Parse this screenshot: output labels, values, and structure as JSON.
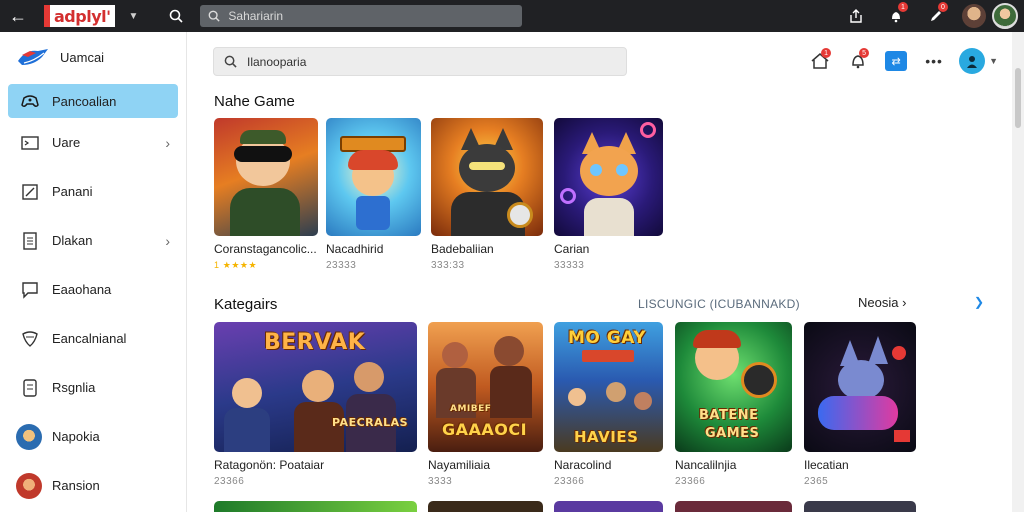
{
  "topbar": {
    "brand": "adplyl'",
    "search_placeholder": "Sahariarin",
    "badges": [
      "1",
      "1",
      "0"
    ]
  },
  "sidebar": {
    "brand_label": "Uamcai",
    "items": [
      {
        "label": "Pancoalian",
        "icon": "gamepad-icon",
        "active": true
      },
      {
        "label": "Uare",
        "icon": "screen-icon",
        "chevron": true
      },
      {
        "label": "Panani",
        "icon": "edit-icon"
      },
      {
        "label": "Dlakan",
        "icon": "document-icon",
        "chevron": true
      },
      {
        "label": "Eaaohana",
        "icon": "chat-icon"
      },
      {
        "label": "Eancalnianal",
        "icon": "shield-icon"
      },
      {
        "label": "Rsgnlia",
        "icon": "tablet-icon"
      },
      {
        "label": "Napokia",
        "icon": "avatar"
      },
      {
        "label": "Ransion",
        "icon": "avatar"
      }
    ]
  },
  "main": {
    "search_placeholder": "Ilanooparia",
    "action_badges": [
      "1",
      "5"
    ],
    "section1_title": "Nahe Game",
    "games": [
      {
        "title": "Coranstagancolic...",
        "sub": "",
        "stars": "★★★★",
        "rating": "1"
      },
      {
        "title": "Nacadhirid",
        "sub": "23333"
      },
      {
        "title": "Badebaliian",
        "sub": "333:33"
      },
      {
        "title": "Carian",
        "sub": "33333"
      }
    ],
    "section2_title": "Kategairs",
    "filter_text": "LISCUNGIC (ICUBANNAKD)",
    "see_more": "Neosia",
    "categories": [
      {
        "title": "Ratagonön:",
        "title2": "Poataiar",
        "sub": "23366",
        "art_text": "BERVAK",
        "art_sub": "PAECRALAS"
      },
      {
        "title": "Nayamiliaia",
        "sub": "3333",
        "art_text": "GAAAOCI",
        "art_sub": "AMIBEF"
      },
      {
        "title": "Naracolind",
        "sub": "23366",
        "art_text": "MO GAY",
        "art_sub": "HAVIES"
      },
      {
        "title": "Nancalilnjia",
        "sub": "23366",
        "art_text": "BATENE",
        "art_sub": "GAMES"
      },
      {
        "title": "Ilecatian",
        "sub": "2365"
      }
    ]
  },
  "colors": {
    "topbar_bg": "#202124",
    "active_item_bg": "#8fd3f4",
    "accent_blue": "#1e88e5",
    "badge_red": "#e53935"
  }
}
